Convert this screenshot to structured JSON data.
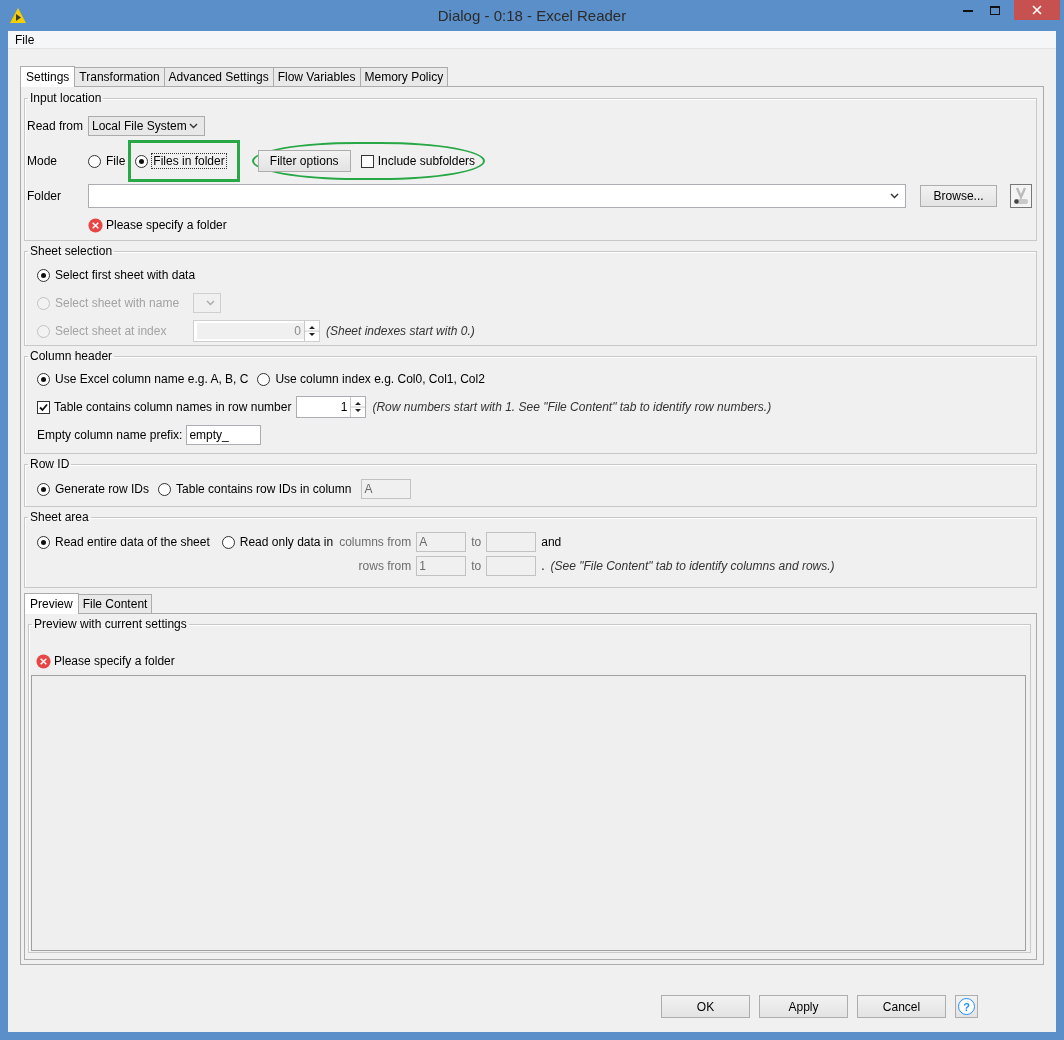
{
  "window": {
    "title": "Dialog - 0:18 - Excel Reader"
  },
  "menu": [
    {
      "label": "File"
    }
  ],
  "tabs": [
    {
      "label": "Settings",
      "selected": true
    },
    {
      "label": "Transformation",
      "selected": false
    },
    {
      "label": "Advanced Settings",
      "selected": false
    },
    {
      "label": "Flow Variables",
      "selected": false
    },
    {
      "label": "Memory Policy",
      "selected": false
    }
  ],
  "input_location": {
    "title": "Input location",
    "read_from": {
      "label": "Read from",
      "value": "Local File System"
    },
    "mode": {
      "label": "Mode",
      "options": [
        {
          "label": "File",
          "selected": false
        },
        {
          "label": "Files in folder",
          "selected": true
        }
      ],
      "filter_button": "Filter options",
      "include_subfolders": {
        "label": "Include subfolders",
        "checked": false
      }
    },
    "folder": {
      "label": "Folder",
      "browse_button": "Browse..."
    },
    "error": "Please specify a folder"
  },
  "sheet_selection": {
    "title": "Sheet selection",
    "options": [
      {
        "kind": "plain",
        "label": "Select first sheet with data",
        "selected": true,
        "disabled": false
      },
      {
        "kind": "dropdown",
        "label": "Select sheet with name",
        "selected": false,
        "disabled": true
      },
      {
        "kind": "spinner",
        "label": "Select sheet at index",
        "selected": false,
        "disabled": true,
        "value": "0",
        "note": "(Sheet indexes start with 0.)"
      }
    ]
  },
  "column_header": {
    "title": "Column header",
    "options": [
      {
        "label": "Use Excel column name e.g. A, B, C",
        "selected": true
      },
      {
        "label": "Use column index e.g. Col0, Col1, Col2",
        "selected": false
      }
    ],
    "names_row": {
      "label": "Table contains column names in row number",
      "checked": true,
      "value": "1",
      "note": "(Row numbers start with 1. See \"File Content\" tab to identify row numbers.)"
    },
    "prefix": {
      "label": "Empty column name prefix:",
      "value": "empty_"
    }
  },
  "row_id": {
    "title": "Row ID",
    "options": [
      {
        "label": "Generate row IDs",
        "selected": true
      },
      {
        "label": "Table contains row IDs in column",
        "selected": false
      }
    ],
    "column": {
      "value": "A",
      "disabled": true
    }
  },
  "sheet_area": {
    "title": "Sheet area",
    "options": [
      {
        "label": "Read entire data of the sheet",
        "selected": true
      },
      {
        "label": "Read only data in",
        "selected": false
      }
    ],
    "columns_label": "columns from",
    "columns_from": {
      "value": "A",
      "disabled": true
    },
    "columns_to_label": "to",
    "columns_to": {
      "disabled": true
    },
    "and": "and",
    "rows_label": "rows from",
    "rows_from": {
      "value": "1",
      "disabled": true
    },
    "rows_to_label": "to",
    "rows_to": {
      "disabled": true
    },
    "period": ".",
    "note": "(See \"File Content\" tab to identify columns and rows.)"
  },
  "preview_tabs": [
    {
      "label": "Preview",
      "selected": true
    },
    {
      "label": "File Content",
      "selected": false
    }
  ],
  "preview": {
    "title": "Preview with current settings",
    "error": "Please specify a folder"
  },
  "buttons": [
    {
      "label": "OK"
    },
    {
      "label": "Apply"
    },
    {
      "label": "Cancel"
    }
  ],
  "help_button": {
    "label": "?"
  }
}
